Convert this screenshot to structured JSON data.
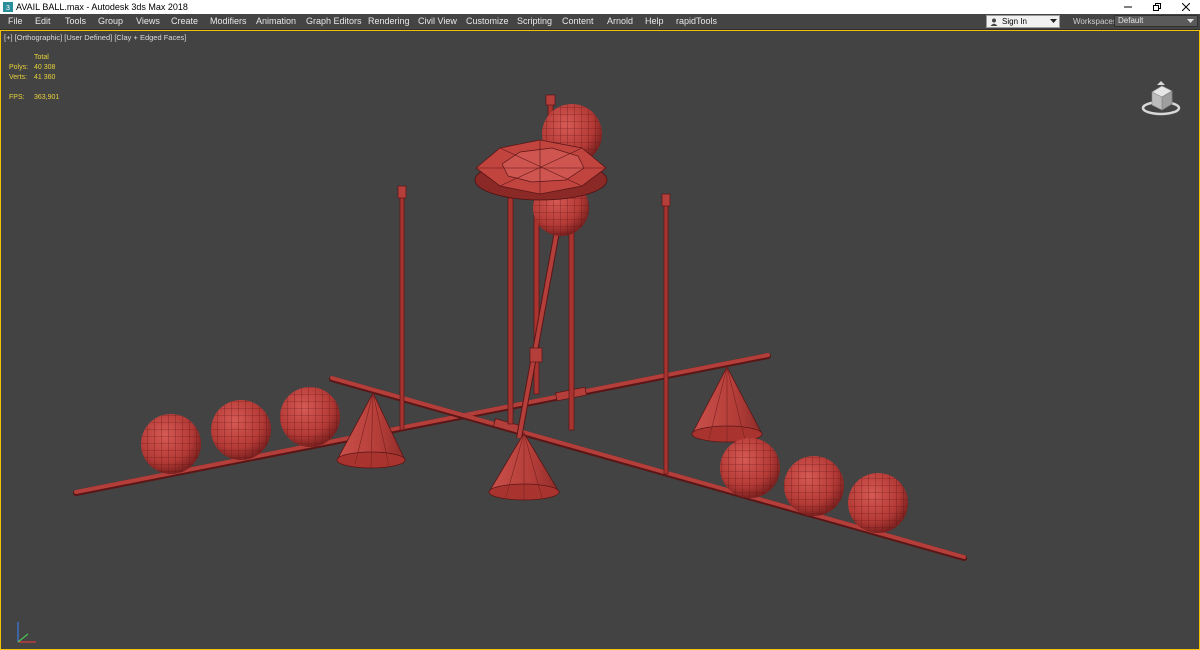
{
  "window": {
    "title": "AVAIL BALL.max - Autodesk 3ds Max 2018",
    "controls": [
      "minimize-icon",
      "restore-icon",
      "close-icon"
    ]
  },
  "menu": {
    "items": [
      "File",
      "Edit",
      "Tools",
      "Group",
      "Views",
      "Create",
      "Modifiers",
      "Animation",
      "Graph Editors",
      "Rendering",
      "Civil View",
      "Customize",
      "Scripting",
      "Content",
      "Arnold",
      "Help",
      "rapidTools"
    ],
    "sign_in": "Sign In",
    "workspaces_label": "Workspaces:",
    "workspace_value": "Default"
  },
  "viewport": {
    "labels": [
      "[+]",
      "[Orthographic]",
      "[User Defined]",
      "[Clay + Edged Faces]"
    ],
    "stats": {
      "total_label": "Total",
      "polys_label": "Polys:",
      "polys_value": "40 308",
      "verts_label": "Verts:",
      "verts_value": "41 360",
      "fps_label": "FPS:",
      "fps_value": "363,901"
    },
    "border_color": "#f2c200",
    "clay_color": "#b83b3b"
  }
}
